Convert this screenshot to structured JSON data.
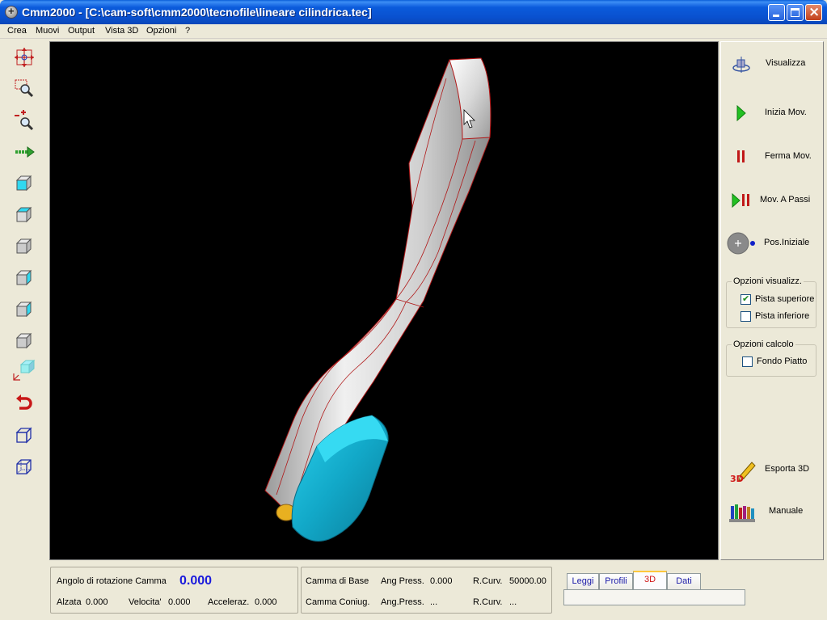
{
  "window": {
    "title": "Cmm2000 - [C:\\cam-soft\\cmm2000\\tecnofile\\lineare cilindrica.tec]"
  },
  "menu": [
    "Crea",
    "Muovi",
    "Output",
    "Vista 3D",
    "Opzioni",
    "?"
  ],
  "left_toolbar": [
    {
      "name": "pan-icon"
    },
    {
      "name": "zoom-window-icon"
    },
    {
      "name": "zoom-in-out-icon"
    },
    {
      "name": "move-arrow-icon"
    },
    {
      "name": "view-cube-front-icon"
    },
    {
      "name": "view-cube-top-icon"
    },
    {
      "name": "view-cube-left-icon"
    },
    {
      "name": "view-cube-right-icon"
    },
    {
      "name": "view-cube-bottom-icon"
    },
    {
      "name": "view-cube-back-icon"
    },
    {
      "name": "view-cube-iso-axes-icon"
    },
    {
      "name": "rotate-back-icon"
    },
    {
      "name": "view-box-icon"
    },
    {
      "name": "wireframe-box-icon"
    }
  ],
  "right_panel": {
    "visualizza": "Visualizza",
    "inizia_mov": "Inizia Mov.",
    "ferma_mov": "Ferma Mov.",
    "mov_a_passi": "Mov. A Passi",
    "pos_iniziale": "Pos.Iniziale",
    "opzioni_visualizz": {
      "legend": "Opzioni visualizz.",
      "pista_superiore": {
        "label": "Pista superiore",
        "checked": true
      },
      "pista_inferiore": {
        "label": "Pista inferiore",
        "checked": false
      }
    },
    "opzioni_calcolo": {
      "legend": "Opzioni calcolo",
      "fondo_piatto": {
        "label": "Fondo Piatto",
        "checked": false
      }
    },
    "esporta_3d": "Esporta 3D",
    "esporta_3d_icon_text": "3D",
    "manuale": "Manuale"
  },
  "status": {
    "angolo_label": "Angolo di rotazione Camma",
    "angolo_value": "0.000",
    "alzata_label": "Alzata",
    "alzata_value": "0.000",
    "velocita_label": "Velocita'",
    "velocita_value": "0.000",
    "acceleraz_label": "Acceleraz.",
    "acceleraz_value": "0.000",
    "camma_base_label": "Camma di Base",
    "ang_press_label": "Ang Press.",
    "ang_press_value": "0.000",
    "r_curv_label": "R.Curv.",
    "r_curv_value": "50000.00",
    "camma_coniug_label": "Camma Coniug.",
    "ang_press2_label": "Ang.Press.",
    "ang_press2_value": "...",
    "r_curv2_label": "R.Curv.",
    "r_curv2_value": "..."
  },
  "tabs": [
    {
      "label": "Leggi",
      "active": false
    },
    {
      "label": "Profili",
      "active": false
    },
    {
      "label": "3D",
      "active": true
    },
    {
      "label": "Dati",
      "active": false
    }
  ],
  "colors": {
    "cam_face": "#1bb8d8",
    "track_body": "#c8c8c8",
    "edge_lines": "#b01818",
    "angle_value": "#1a1adc"
  }
}
